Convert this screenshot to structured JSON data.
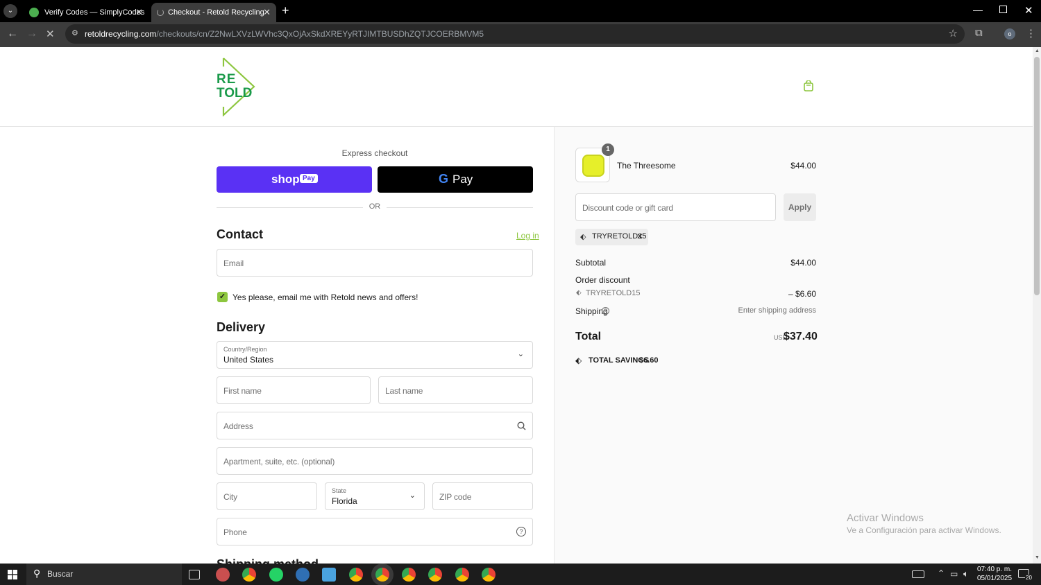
{
  "browser": {
    "tabs": [
      {
        "title": "Verify Codes — SimplyCodes",
        "active": false
      },
      {
        "title": "Checkout - Retold Recycling",
        "active": true
      }
    ],
    "url_host": "retoldrecycling.com",
    "url_path": "/checkouts/cn/Z2NwLXVzLWVhc3QxOjAxSkdXREYyRTJIMTBUSDhZQTJCOERBMVM5"
  },
  "brand": {
    "logo_line1": "RE",
    "logo_line2": "TOLD",
    "accent_color": "#8dc63f",
    "logo_color": "#1a9a4a"
  },
  "express": {
    "title": "Express checkout",
    "shop_label": "shop",
    "shop_pay_badge": "Pay",
    "gpay_label": "Pay",
    "or_label": "OR"
  },
  "contact": {
    "heading": "Contact",
    "login_link": "Log in",
    "email_placeholder": "Email",
    "newsletter_label": "Yes please, email me with Retold news and offers!"
  },
  "delivery": {
    "heading": "Delivery",
    "country_label": "Country/Region",
    "country_value": "United States",
    "first_name_placeholder": "First name",
    "last_name_placeholder": "Last name",
    "address_placeholder": "Address",
    "apartment_placeholder": "Apartment, suite, etc. (optional)",
    "city_placeholder": "City",
    "state_label": "State",
    "state_value": "Florida",
    "zip_placeholder": "ZIP code",
    "phone_placeholder": "Phone",
    "shipping_method_heading": "Shipping method"
  },
  "summary": {
    "item": {
      "name": "The Threesome",
      "price": "$44.00",
      "quantity": "1"
    },
    "discount_placeholder": "Discount code or gift card",
    "apply_label": "Apply",
    "applied_code": "TRYRETOLD15",
    "subtotal_label": "Subtotal",
    "subtotal_value": "$44.00",
    "order_discount_label": "Order discount",
    "order_discount_code": "TRYRETOLD15",
    "order_discount_value": "– $6.60",
    "shipping_label": "Shipping",
    "shipping_value": "Enter shipping address",
    "total_label": "Total",
    "total_currency": "USD",
    "total_value": "$37.40",
    "savings_label": "TOTAL SAVINGS",
    "savings_value": "$6.60"
  },
  "watermark": {
    "line1": "Activar Windows",
    "line2": "Ve a Configuración para activar Windows."
  },
  "taskbar": {
    "search_label": "Buscar",
    "time": "07:40 p. m.",
    "date": "05/01/2025",
    "notification_count": "20"
  }
}
